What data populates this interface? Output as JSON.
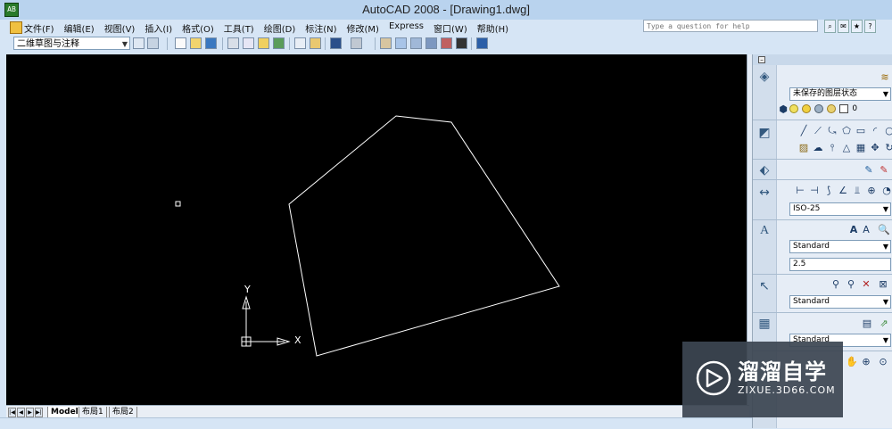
{
  "window": {
    "app_icon_text": "AB",
    "title": "AutoCAD 2008 - [Drawing1.dwg]"
  },
  "menu": {
    "items": [
      "文件(F)",
      "编辑(E)",
      "视图(V)",
      "插入(I)",
      "格式(O)",
      "工具(T)",
      "绘图(D)",
      "标注(N)",
      "修改(M)",
      "Express",
      "窗口(W)",
      "帮助(H)"
    ]
  },
  "help_search": {
    "placeholder": "Type a question for help"
  },
  "toolbar": {
    "workspace": "二维草图与注释",
    "icons": [
      "qnew-icon",
      "qsave-window-icon",
      "new-icon",
      "open-icon",
      "save-icon",
      "plot-icon",
      "plot-preview-icon",
      "publish-icon",
      "3dprint-icon",
      "cut-icon",
      "matchprop-icon",
      "undo-icon",
      "redo-icon",
      "pan-icon",
      "zoom-window-icon",
      "zoom-previous-icon",
      "properties-icon",
      "designcenter-icon",
      "toolpalettes-icon",
      "calculator-icon",
      "help-icon"
    ]
  },
  "drawing": {
    "axis_y": "Y",
    "axis_x": "X",
    "shape": "pentagon-outline",
    "line_color": "#ffffff",
    "background": "#000000"
  },
  "layout_tabs": [
    {
      "label": "Model",
      "active": true
    },
    {
      "label": "布局1",
      "active": false
    },
    {
      "label": "布局2",
      "active": false
    }
  ],
  "palette": {
    "layer_state": "未保存的图层状态",
    "current_layer": "0",
    "dim_style": "ISO-25",
    "text_style": "Standard",
    "text_height": "2.5",
    "mleader_style": "Standard",
    "table_style": "Standard"
  },
  "watermark": {
    "title": "溜溜自学",
    "subtitle": "ZIXUE.3D66.COM"
  },
  "colors": {
    "chrome": "#d6e5f5",
    "titlebar": "#b9d3ee",
    "canvas": "#000000",
    "watermark_bg": "#3c4652"
  }
}
